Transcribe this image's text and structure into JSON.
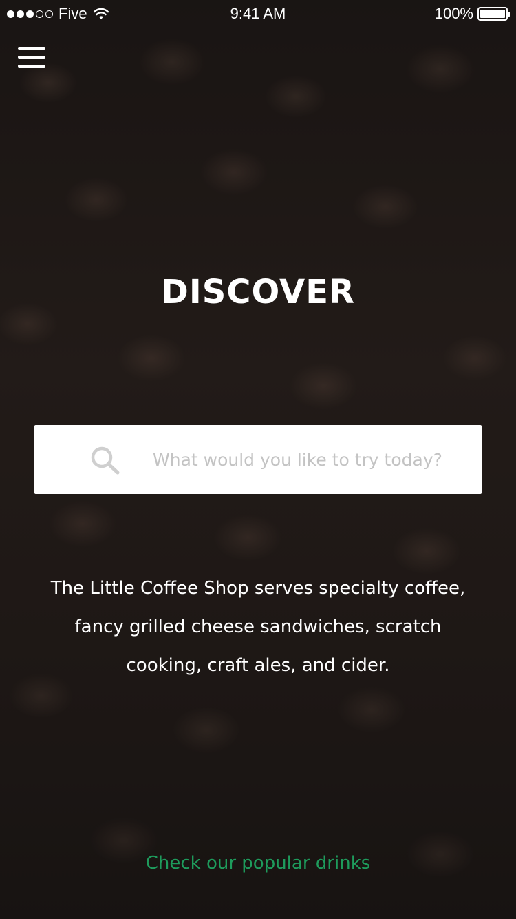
{
  "status_bar": {
    "carrier": "Five",
    "time": "9:41 AM",
    "battery": "100%",
    "signal_strength": 3,
    "signal_max": 5,
    "battery_level": 1.0
  },
  "menu": {
    "icon": "hamburger-menu-icon"
  },
  "hero": {
    "title": "DISCOVER"
  },
  "search": {
    "placeholder": "What would you like to try today?",
    "value": "",
    "icon": "search-icon"
  },
  "description": {
    "text": "The Little Coffee Shop serves specialty coffee, fancy grilled cheese sandwiches, scratch cooking, craft ales, and cider."
  },
  "cta": {
    "label": "Check our popular drinks"
  },
  "colors": {
    "accent": "#1e9b5c",
    "text": "#ffffff",
    "search_background": "#ffffff",
    "placeholder": "#c3c3c3"
  }
}
